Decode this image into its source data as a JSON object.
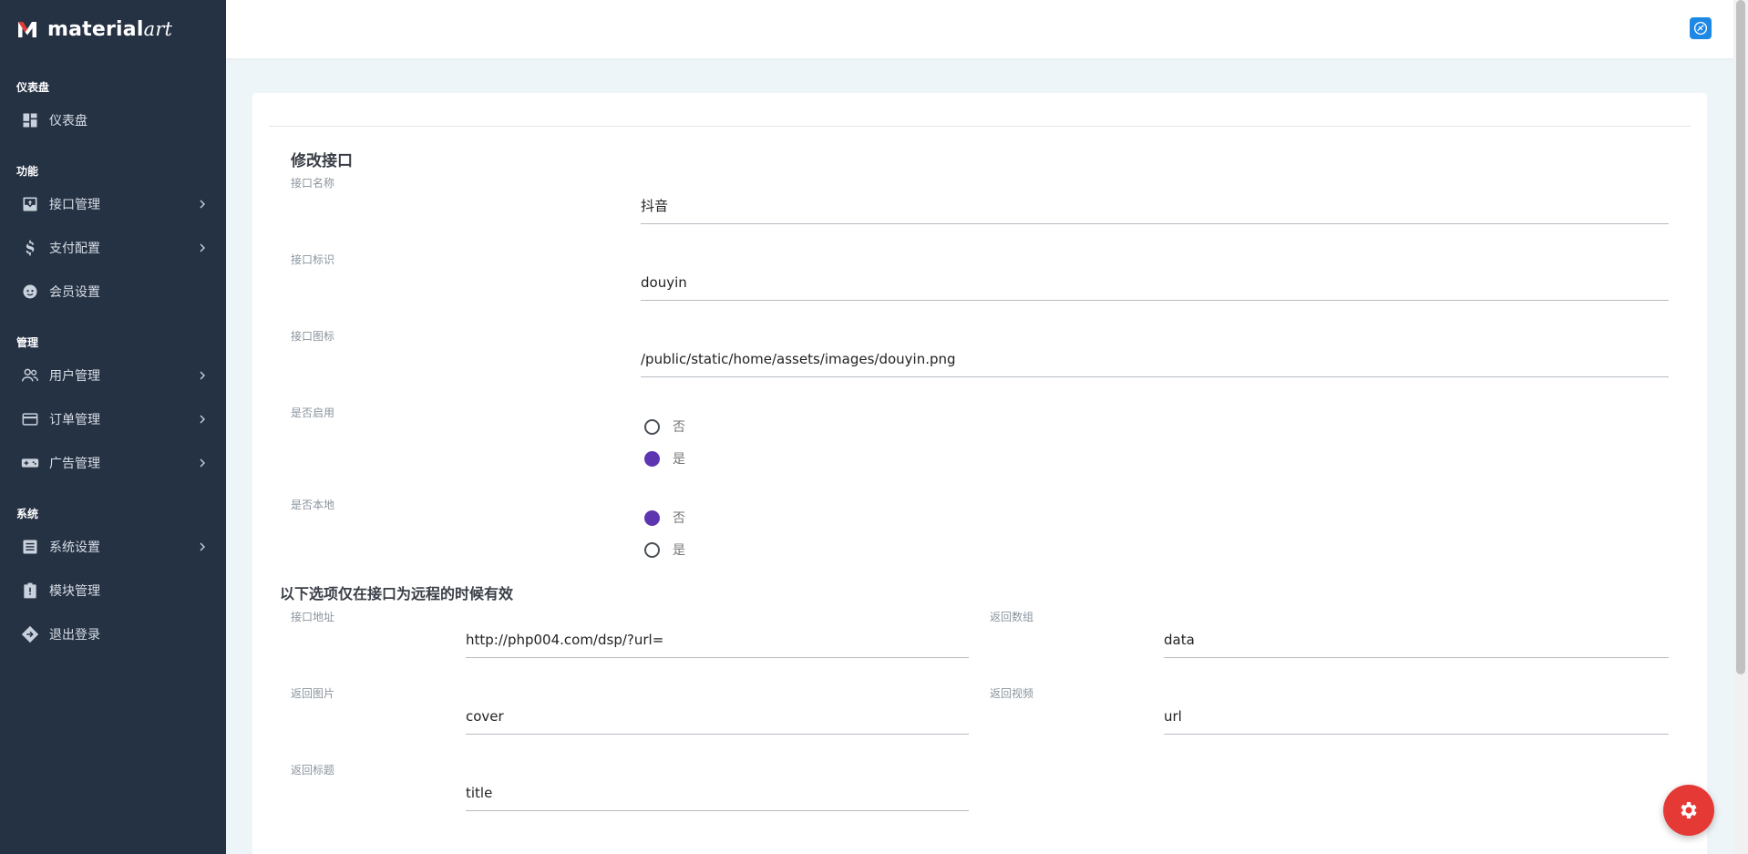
{
  "brand": {
    "name_bold": "material",
    "name_light": "art"
  },
  "sidebar": {
    "sections": [
      {
        "title": "仪表盘",
        "items": [
          {
            "label": "仪表盘",
            "icon": "dashboard-icon",
            "has_children": false
          }
        ]
      },
      {
        "title": "功能",
        "items": [
          {
            "label": "接口管理",
            "icon": "inbox-icon",
            "has_children": true
          },
          {
            "label": "支付配置",
            "icon": "dollar-icon",
            "has_children": true
          },
          {
            "label": "会员设置",
            "icon": "face-icon",
            "has_children": false
          }
        ]
      },
      {
        "title": "管理",
        "items": [
          {
            "label": "用户管理",
            "icon": "users-icon",
            "has_children": true
          },
          {
            "label": "订单管理",
            "icon": "credit-card-icon",
            "has_children": true
          },
          {
            "label": "广告管理",
            "icon": "gamepad-icon",
            "has_children": true
          }
        ]
      },
      {
        "title": "系统",
        "items": [
          {
            "label": "系统设置",
            "icon": "list-icon",
            "has_children": true
          },
          {
            "label": "模块管理",
            "icon": "clipboard-icon",
            "has_children": false
          },
          {
            "label": "退出登录",
            "icon": "exit-icon",
            "has_children": false
          }
        ]
      }
    ]
  },
  "form": {
    "title": "修改接口",
    "name": {
      "label": "接口名称",
      "value": "抖音"
    },
    "identifier": {
      "label": "接口标识",
      "value": "douyin"
    },
    "icon": {
      "label": "接口图标",
      "value": "/public/static/home/assets/images/douyin.png"
    },
    "enabled": {
      "label": "是否启用",
      "options": [
        "否",
        "是"
      ],
      "selected": "是"
    },
    "local": {
      "label": "是否本地",
      "options": [
        "否",
        "是"
      ],
      "selected": "否"
    },
    "remote_section_title": "以下选项仅在接口为远程的时候有效",
    "api_url": {
      "label": "接口地址",
      "value": "http://php004.com/dsp/?url="
    },
    "return_array": {
      "label": "返回数组",
      "value": "data"
    },
    "return_image": {
      "label": "返回图片",
      "value": "cover"
    },
    "return_video": {
      "label": "返回视频",
      "value": "url"
    },
    "return_title": {
      "label": "返回标题",
      "value": "title"
    }
  },
  "colors": {
    "sidebar_bg": "#253244",
    "accent_radio": "#5e35b1",
    "fab": "#e53935",
    "topbar_icon": "#1e88e5"
  }
}
